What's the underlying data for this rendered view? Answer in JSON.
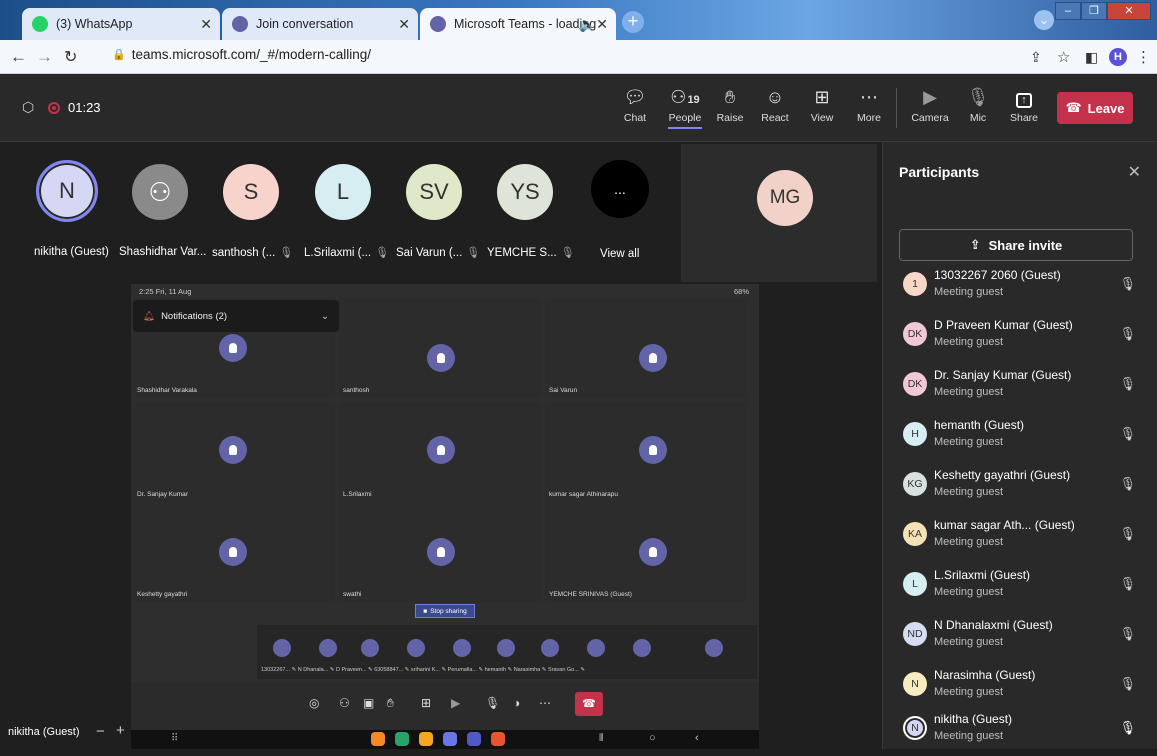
{
  "browser": {
    "tabs": [
      {
        "title": "(3) WhatsApp",
        "icon": "whatsapp-icon",
        "color": "#25d366"
      },
      {
        "title": "Join conversation",
        "icon": "teams-icon",
        "color": "#6264a7"
      },
      {
        "title": "Microsoft Teams - loading",
        "icon": "teams-icon",
        "color": "#6264a7"
      }
    ],
    "url": "teams.microsoft.com/_#/modern-calling/",
    "profile_initial": "H"
  },
  "meeting": {
    "timer": "01:23",
    "toolbar": {
      "chat": "Chat",
      "people": "People",
      "people_count": "19",
      "raise": "Raise",
      "react": "React",
      "view": "View",
      "more": "More",
      "camera": "Camera",
      "mic": "Mic",
      "share": "Share",
      "leave": "Leave"
    },
    "gallery": [
      {
        "initials": "N",
        "name": "nikitha (Guest)",
        "color": "#d6d6f5",
        "muted": false
      },
      {
        "initials": "",
        "name": "Shashidhar Var...",
        "color": "#8a8a8a",
        "muted": false
      },
      {
        "initials": "S",
        "name": "santhosh (...",
        "color": "#f7d3cc",
        "muted": true
      },
      {
        "initials": "L",
        "name": "L.Srilaxmi (...",
        "color": "#d6eef2",
        "muted": true
      },
      {
        "initials": "SV",
        "name": "Sai Varun (...",
        "color": "#dfe8c8",
        "muted": true
      },
      {
        "initials": "YS",
        "name": "YEMCHE S...",
        "color": "#dfe4d8",
        "muted": true
      }
    ],
    "view_all": "View all",
    "more_glyph": "...",
    "spotlight_initials": "MG",
    "bottom_name": "nikitha (Guest)"
  },
  "shared_screen": {
    "status_time": "2:25 Fri, 11 Aug",
    "status_battery": "68%",
    "notification": "Notifications (2)",
    "tiles": [
      "Shashidhar Varakala",
      "santhosh",
      "Sai Varun",
      "Dr. Sanjay Kumar",
      "L.Srilaxmi",
      "kumar sagar Athinarapu",
      "Keshetty gayathri",
      "swathi",
      "YEMCHE SRINIVAS (Guest)"
    ],
    "stop_sharing": "Stop sharing",
    "mini_labels": "13032267... ✎  N Dhanala... ✎  D Praveen... ✎  63058847... ✎  sriharini K... ✎  Perumalla... ✎  hemanth ✎  Narasimha ✎  Sravan Go... ✎"
  },
  "participants": {
    "title": "Participants",
    "share_invite": "Share invite",
    "list": [
      {
        "initials": "1",
        "name": "13032267 2060 (Guest)",
        "role": "Meeting guest",
        "color": "#f7d8c8"
      },
      {
        "initials": "DK",
        "name": "D Praveen Kumar (Guest)",
        "role": "Meeting guest",
        "color": "#f2c8d6"
      },
      {
        "initials": "DK",
        "name": "Dr. Sanjay Kumar (Guest)",
        "role": "Meeting guest",
        "color": "#f2c8d6"
      },
      {
        "initials": "H",
        "name": "hemanth (Guest)",
        "role": "Meeting guest",
        "color": "#d6eef2"
      },
      {
        "initials": "KG",
        "name": "Keshetty gayathri (Guest)",
        "role": "Meeting guest",
        "color": "#d8e0e0"
      },
      {
        "initials": "KA",
        "name": "kumar sagar Ath... (Guest)",
        "role": "Meeting guest",
        "color": "#f7e2b8"
      },
      {
        "initials": "L",
        "name": "L.Srilaxmi (Guest)",
        "role": "Meeting guest",
        "color": "#d6eef2"
      },
      {
        "initials": "ND",
        "name": "N Dhanalaxmi (Guest)",
        "role": "Meeting guest",
        "color": "#d6dcf2"
      },
      {
        "initials": "N",
        "name": "Narasimha (Guest)",
        "role": "Meeting guest",
        "color": "#f7ecc0"
      },
      {
        "initials": "N",
        "name": "nikitha (Guest)",
        "role": "Meeting guest",
        "color": "#d6d6f5"
      }
    ]
  },
  "colors": {
    "accent": "#6264a7",
    "leave": "#c4314b"
  }
}
